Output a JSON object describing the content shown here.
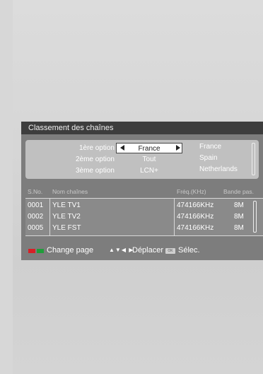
{
  "title": "Classement des chaînes",
  "options": [
    {
      "label": "1ère option",
      "value": "France"
    },
    {
      "label": "2ème option",
      "value": "Tout"
    },
    {
      "label": "3ème option",
      "value": "LCN+"
    }
  ],
  "countries": [
    "France",
    "Spain",
    "Netherlands"
  ],
  "list_headers": {
    "sno": "S.No.",
    "name": "Nom chaînes",
    "freq": "Fréq.(KHz)",
    "band": "Bande pas."
  },
  "channels": [
    {
      "sno": "0001",
      "name": "YLE TV1",
      "freq": "474166KHz",
      "band": "8M"
    },
    {
      "sno": "0002",
      "name": "YLE TV2",
      "freq": "474166KHz",
      "band": "8M"
    },
    {
      "sno": "0005",
      "name": "YLE FST",
      "freq": "474166KHz",
      "band": "8M"
    }
  ],
  "footer": {
    "change_page": "Change page",
    "nav_symbols": "▲▼◀ ▶",
    "move": "Déplacer",
    "ok_key": "OK",
    "select": "Sélec."
  },
  "colors": {
    "red_key": "#d81f26",
    "green_key": "#1f9d3a",
    "title_bar": "#3d3d3d",
    "osd_bg": "#7d7d7d"
  }
}
